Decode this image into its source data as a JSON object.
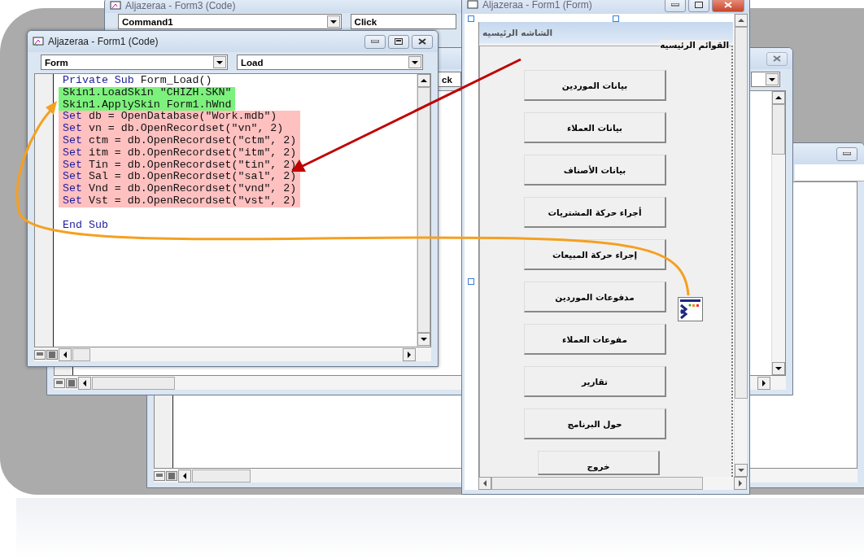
{
  "form3_code_window": {
    "title": "Aljazeraa - Form3 (Code)",
    "object_combo": "Command1",
    "procedure_combo": "Click"
  },
  "back_code_window": {
    "procedure_combo": "ck"
  },
  "code_window": {
    "title": "Aljazeraa - Form1 (Code)",
    "object_combo": "Form",
    "procedure_combo": "Load",
    "lines": [
      {
        "kind": "code",
        "segments": [
          {
            "kind": "keyword",
            "text": "Private Sub"
          },
          {
            "kind": "plain",
            "text": " Form_Load()"
          }
        ]
      },
      {
        "kind": "code",
        "color": "#7cf27c",
        "segments": [
          {
            "kind": "plain",
            "text": "Skin1.LoadSkin \"CHIZH.SKN\""
          }
        ]
      },
      {
        "kind": "code",
        "color": "#7cf27c",
        "segments": [
          {
            "kind": "plain",
            "text": "Skin1.ApplySkin Form1.hWnd"
          }
        ]
      },
      {
        "kind": "code",
        "color": "#ffc0c0",
        "segments": [
          {
            "kind": "keyword",
            "text": "Set"
          },
          {
            "kind": "plain",
            "text": " db = OpenDatabase(\"Work.mdb\")"
          }
        ]
      },
      {
        "kind": "code",
        "color": "#ffc0c0",
        "segments": [
          {
            "kind": "keyword",
            "text": "Set"
          },
          {
            "kind": "plain",
            "text": " vn = db.OpenRecordset(\"vn\", 2)"
          }
        ]
      },
      {
        "kind": "code",
        "color": "#ffc0c0",
        "segments": [
          {
            "kind": "keyword",
            "text": "Set"
          },
          {
            "kind": "plain",
            "text": " ctm = db.OpenRecordset(\"ctm\", 2)"
          }
        ]
      },
      {
        "kind": "code",
        "color": "#ffc0c0",
        "segments": [
          {
            "kind": "keyword",
            "text": "Set"
          },
          {
            "kind": "plain",
            "text": " itm = db.OpenRecordset(\"itm\", 2)"
          }
        ]
      },
      {
        "kind": "code",
        "color": "#ffc0c0",
        "segments": [
          {
            "kind": "keyword",
            "text": "Set"
          },
          {
            "kind": "plain",
            "text": " Tin = db.OpenRecordset(\"tin\", 2)"
          }
        ]
      },
      {
        "kind": "code",
        "color": "#ffc0c0",
        "segments": [
          {
            "kind": "keyword",
            "text": "Set"
          },
          {
            "kind": "plain",
            "text": " Sal = db.OpenRecordset(\"sal\", 2)"
          }
        ]
      },
      {
        "kind": "code",
        "color": "#ffc0c0",
        "segments": [
          {
            "kind": "keyword",
            "text": "Set"
          },
          {
            "kind": "plain",
            "text": " Vnd = db.OpenRecordset(\"vnd\", 2)"
          }
        ]
      },
      {
        "kind": "code",
        "color": "#ffc0c0",
        "segments": [
          {
            "kind": "keyword",
            "text": "Set"
          },
          {
            "kind": "plain",
            "text": " Vst = db.OpenRecordset(\"vst\", 2)"
          }
        ]
      },
      {
        "kind": "blank"
      },
      {
        "kind": "code",
        "segments": [
          {
            "kind": "keyword",
            "text": "End Sub"
          }
        ]
      }
    ]
  },
  "form_window": {
    "title": "Aljazeraa - Form1 (Form)",
    "form_caption": "الشاشه الرئيسيه",
    "frame_label": "القوائم الرئيسيه",
    "buttons": [
      "بيانات الموردين",
      "بيانات العملاء",
      "بيانات الأصناف",
      "أجراء حركة المشتريات",
      "إجراء حركة المبيعات",
      "مدفوعات الموردين",
      "مفوعات العملاء",
      "تقارير",
      "حول البرنامج",
      "خروج"
    ]
  }
}
